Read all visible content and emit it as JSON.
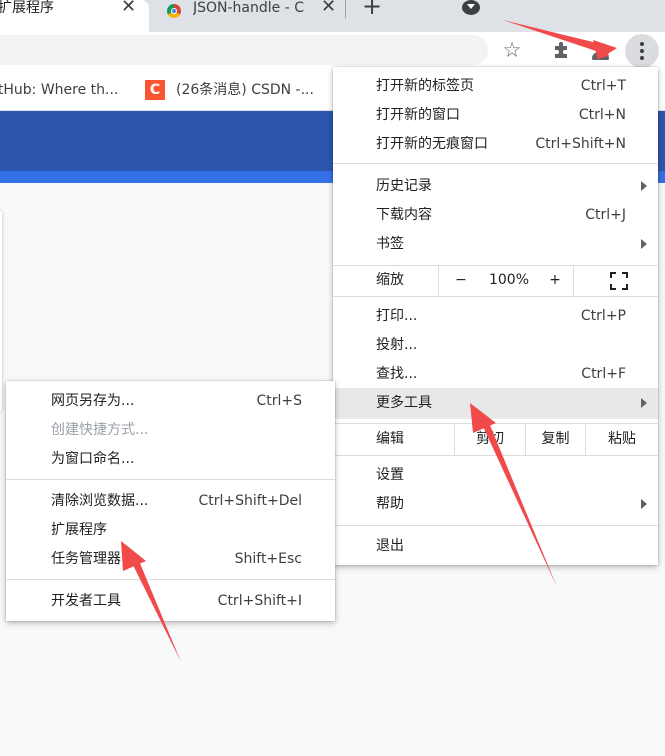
{
  "tabs": [
    {
      "title": "扩展程序",
      "close": "✕",
      "active": true
    },
    {
      "title": "JSON-handle - C",
      "close": "✕",
      "active": false
    }
  ],
  "tabstrip": {
    "new_tab": "+"
  },
  "toolbar": {
    "star": "☆",
    "extensions": "✱"
  },
  "bookmarks": [
    {
      "label": "itHub: Where th..."
    },
    {
      "icon_text": "C",
      "label": "(26条消息) CSDN -..."
    }
  ],
  "main_menu": {
    "group1": [
      {
        "label": "打开新的标签页",
        "shortcut": "Ctrl+T"
      },
      {
        "label": "打开新的窗口",
        "shortcut": "Ctrl+N"
      },
      {
        "label": "打开新的无痕窗口",
        "shortcut": "Ctrl+Shift+N"
      }
    ],
    "group2": [
      {
        "label": "历史记录",
        "submenu": true
      },
      {
        "label": "下载内容",
        "shortcut": "Ctrl+J"
      },
      {
        "label": "书签",
        "submenu": true
      }
    ],
    "zoom": {
      "label": "缩放",
      "minus": "−",
      "value": "100%",
      "plus": "+"
    },
    "group3": [
      {
        "label": "打印...",
        "shortcut": "Ctrl+P"
      },
      {
        "label": "投射..."
      },
      {
        "label": "查找...",
        "shortcut": "Ctrl+F"
      },
      {
        "label": "更多工具",
        "submenu": true,
        "highlighted": true
      }
    ],
    "edit": {
      "label": "编辑",
      "cut": "剪切",
      "copy": "复制",
      "paste": "粘贴"
    },
    "group4": [
      {
        "label": "设置"
      },
      {
        "label": "帮助",
        "submenu": true
      }
    ],
    "exit": {
      "label": "退出"
    }
  },
  "more_tools_menu": {
    "group1": [
      {
        "label": "网页另存为...",
        "shortcut": "Ctrl+S"
      },
      {
        "label": "创建快捷方式...",
        "disabled": true
      },
      {
        "label": "为窗口命名..."
      }
    ],
    "group2": [
      {
        "label": "清除浏览数据...",
        "shortcut": "Ctrl+Shift+Del"
      },
      {
        "label": "扩展程序"
      },
      {
        "label": "任务管理器",
        "shortcut": "Shift+Esc"
      }
    ],
    "group3": [
      {
        "label": "开发者工具",
        "shortcut": "Ctrl+Shift+I"
      }
    ]
  },
  "colors": {
    "annotation_arrow": "#f04a4a",
    "banner": "#2d56ad",
    "highlight": "#e8e8e8"
  }
}
